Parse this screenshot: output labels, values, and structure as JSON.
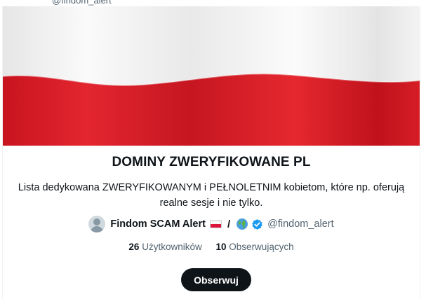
{
  "header": {
    "handle_partial": "@findom_alert"
  },
  "list": {
    "title": "DOMINY ZWERYFIKOWANE PL",
    "description": "Lista dedykowana ZWERYFIKOWANYM i PEŁNOLETNIM kobietom, które np. oferują realne sesje i nie tylko.",
    "owner": {
      "name": "Findom SCAM Alert",
      "separator": "/",
      "handle": "@findom_alert",
      "name_icons": [
        "poland-flag-icon",
        "globe-icon",
        "verified-badge-icon"
      ]
    },
    "stats": {
      "members_count": "26",
      "members_label": "Użytkowników",
      "followers_count": "10",
      "followers_label": "Obserwujących"
    },
    "follow_label": "Obserwuj"
  },
  "colors": {
    "flag_white": "#f2f2f2",
    "flag_red": "#d8202a",
    "button_bg": "#0f1419",
    "verified": "#1d9bf0",
    "secondary_text": "#536471"
  }
}
